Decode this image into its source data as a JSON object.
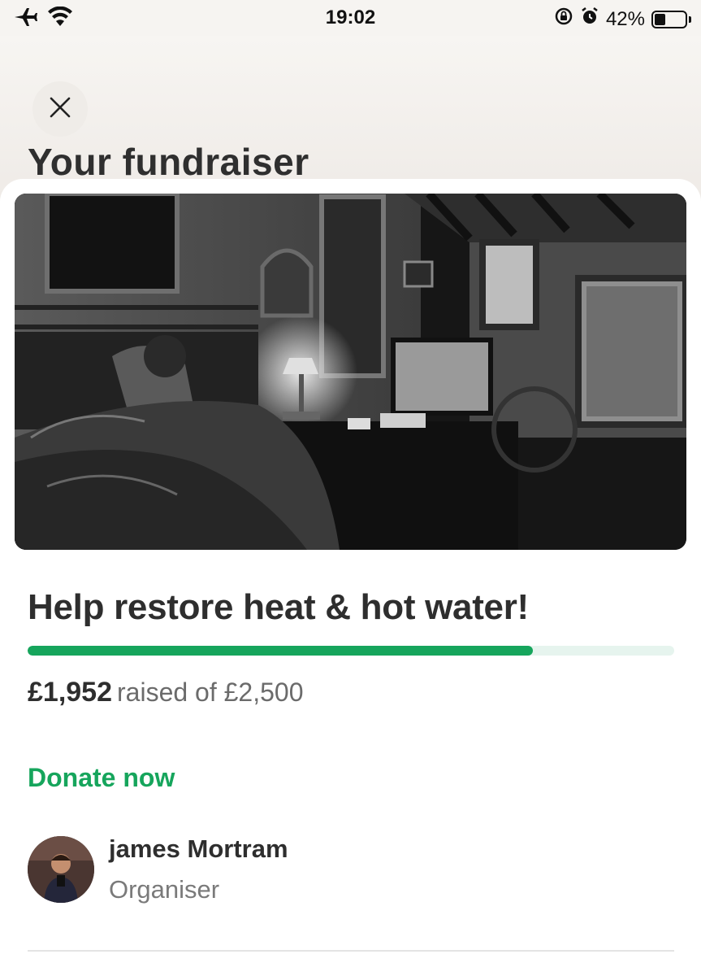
{
  "status_bar": {
    "time": "19:02",
    "battery_percent": "42%",
    "battery_level": 0.42,
    "icons": [
      "airplane-icon",
      "wifi-icon",
      "rotation-lock-icon",
      "alarm-icon",
      "battery-icon"
    ]
  },
  "header": {
    "title": "Your fundraiser",
    "close_icon": "close-icon"
  },
  "fundraiser": {
    "title": "Help restore heat & hot water!",
    "raised": "£1,952",
    "raised_suffix": "raised of £2,500",
    "progress_fraction": 0.7808,
    "donate_label": "Donate now"
  },
  "organiser": {
    "name": "james Mortram",
    "role": "Organiser"
  },
  "colors": {
    "accent": "#16a55c",
    "progress_track": "#e6f4ee",
    "text": "#2e2e2e",
    "muted": "#6b6b6b"
  }
}
